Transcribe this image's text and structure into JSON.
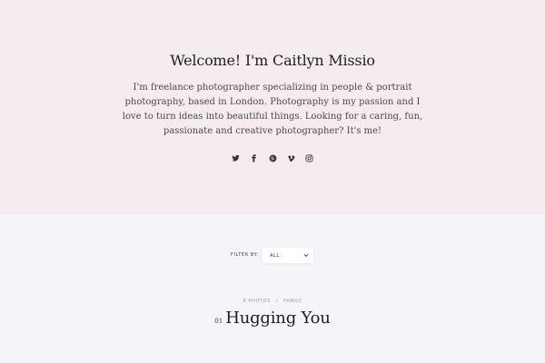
{
  "hero": {
    "title": "Welcome! I'm Caitlyn Missio",
    "bio": "I'm freelance photographer specializing in people & portrait photography, based in London. Photography is my passion and I love to turn ideas into beautiful things. Looking for a caring, fun, passionate and creative photographer? It's me!",
    "background_color": "#f4ecee",
    "social": [
      {
        "icon": "twitter-icon"
      },
      {
        "icon": "facebook-icon"
      },
      {
        "icon": "pinterest-icon"
      },
      {
        "icon": "vimeo-icon"
      },
      {
        "icon": "instagram-icon"
      }
    ]
  },
  "filter": {
    "label": "FILTER BY:",
    "selected": "ALL"
  },
  "gallery": {
    "photo_count": "8 PHOTOS",
    "separator": "/",
    "category": "FAMILY",
    "number": "01",
    "title": "Hugging You"
  },
  "page_background_color": "#f5f5f9"
}
